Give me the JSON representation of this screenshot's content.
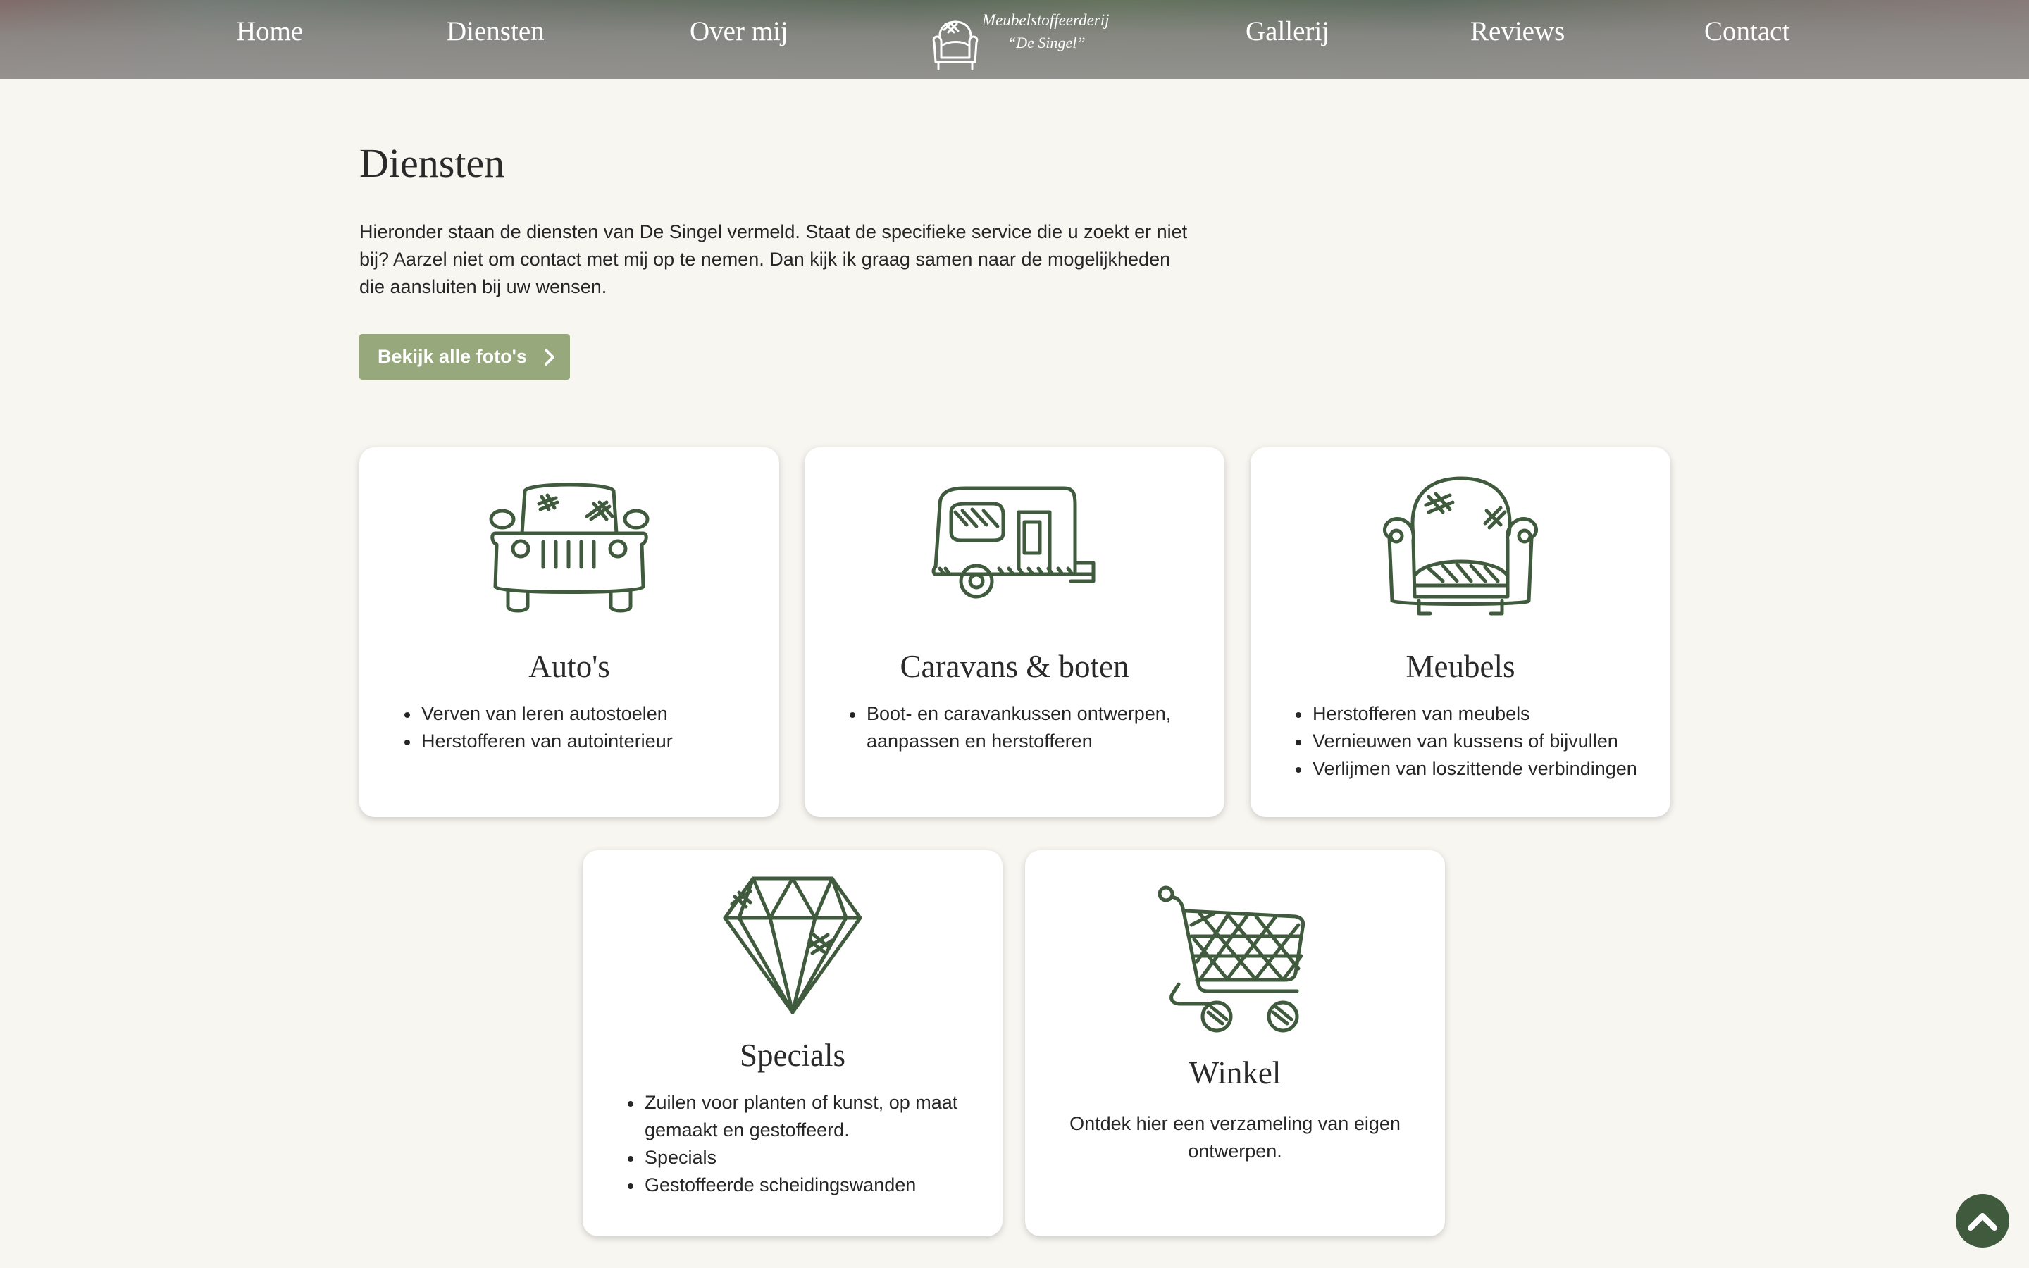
{
  "nav": {
    "left": [
      "Home",
      "Diensten",
      "Over mij"
    ],
    "right": [
      "Gallerij",
      "Reviews",
      "Contact"
    ],
    "logo_line1": "Meubelstoffeerderij",
    "logo_line2": "“De Singel”"
  },
  "main": {
    "title": "Diensten",
    "intro": "Hieronder staan de diensten van De Singel vermeld. Staat de specifieke service die u zoekt er niet bij? Aarzel niet om contact met mij op te nemen. Dan kijk ik graag samen naar de mogelijkheden die aansluiten bij uw wensen.",
    "cta_label": "Bekijk alle foto's"
  },
  "cards": [
    {
      "title": "Auto's",
      "icon": "car-icon",
      "items": [
        "Verven van leren autostoelen",
        "Herstofferen van autointerieur"
      ]
    },
    {
      "title": "Caravans & boten",
      "icon": "caravan-icon",
      "items": [
        "Boot- en caravankussen ontwerpen, aanpassen en herstofferen"
      ]
    },
    {
      "title": "Meubels",
      "icon": "armchair-icon",
      "items": [
        "Herstofferen van meubels",
        "Vernieuwen van kussens of bijvullen",
        "Verlijmen van loszittende verbindingen"
      ]
    },
    {
      "title": "Specials",
      "icon": "diamond-icon",
      "items": [
        "Zuilen voor planten of kunst,  op maat gemaakt en gestoffeerd.",
        "Specials",
        "Gestoffeerde scheidingswanden"
      ]
    },
    {
      "title": "Winkel",
      "icon": "shopping-cart-icon",
      "text": "Ontdek hier een verzameling van eigen ontwerpen."
    }
  ],
  "colors": {
    "icon_stroke": "#3f5a3c",
    "button_bg": "#97a87c",
    "page_bg": "#f8f6f1",
    "to_top_bg": "#3f5a3c"
  },
  "icons": {
    "scroll_top": "chevron-up-icon",
    "cta": "chevron-right-icon"
  }
}
